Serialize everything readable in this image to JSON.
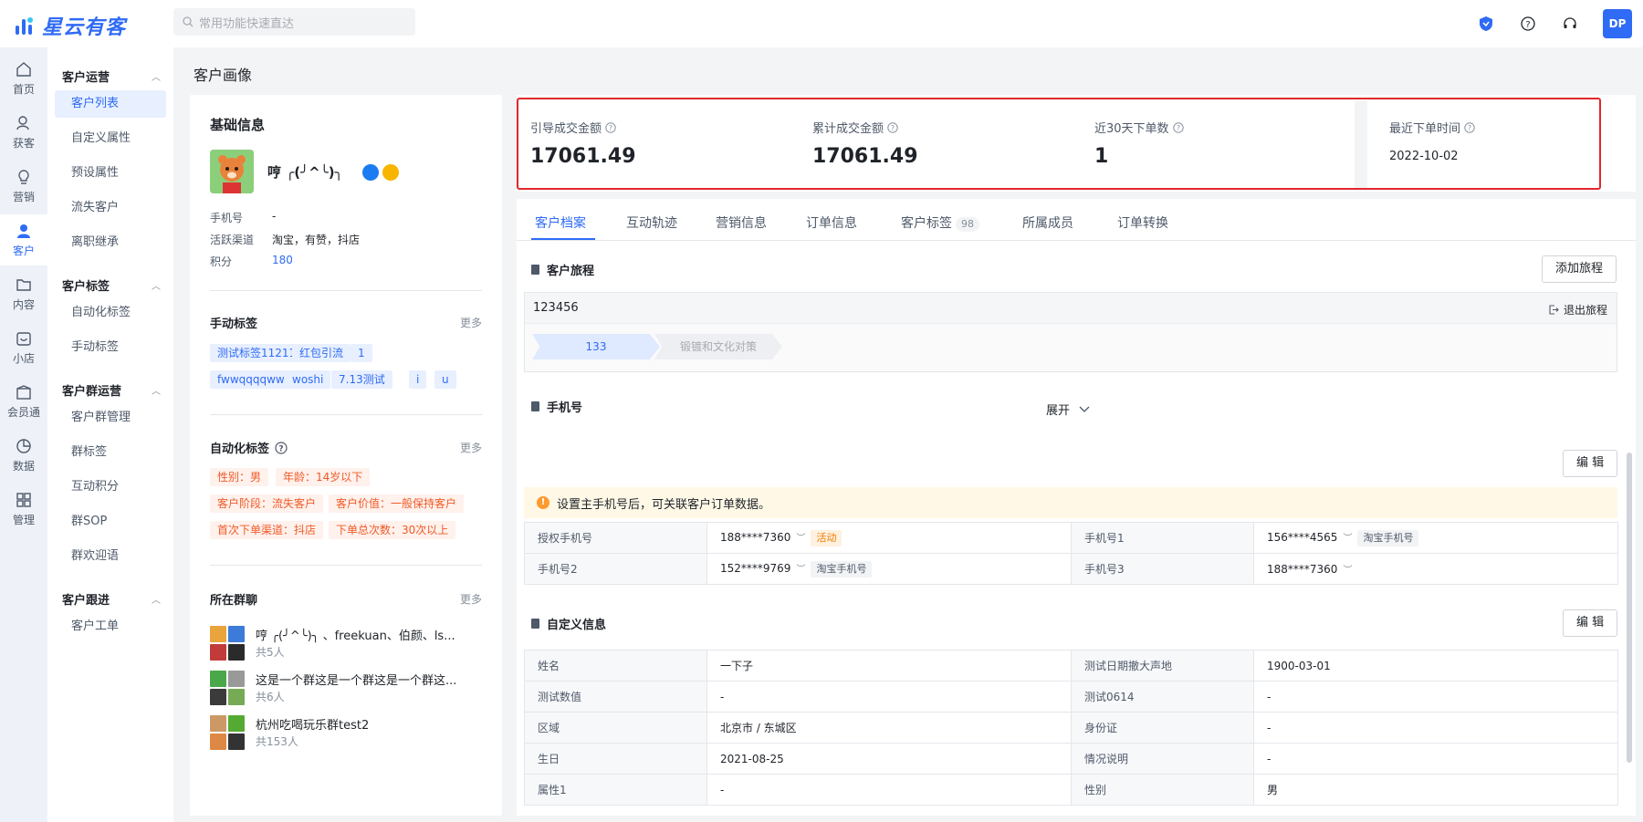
{
  "app": {
    "logo_text": "星云有客",
    "search_placeholder": "常用功能快速直达",
    "user_initials": "DP"
  },
  "rail": [
    {
      "label": "首页",
      "icon": "home-icon"
    },
    {
      "label": "获客",
      "icon": "acquire-icon"
    },
    {
      "label": "营销",
      "icon": "marketing-icon"
    },
    {
      "label": "客户",
      "icon": "customer-icon",
      "active": true
    },
    {
      "label": "内容",
      "icon": "content-icon"
    },
    {
      "label": "小店",
      "icon": "shop-icon"
    },
    {
      "label": "会员通",
      "icon": "member-icon"
    },
    {
      "label": "数据",
      "icon": "data-icon"
    },
    {
      "label": "管理",
      "icon": "manage-icon"
    }
  ],
  "submenu": {
    "groups": [
      {
        "title": "客户运营",
        "items": [
          "客户列表",
          "自定义属性",
          "预设属性",
          "流失客户",
          "离职继承"
        ]
      },
      {
        "title": "客户标签",
        "items": [
          "自动化标签",
          "手动标签"
        ]
      },
      {
        "title": "客户群运营",
        "items": [
          "客户群管理",
          "群标签",
          "互动积分",
          "群SOP",
          "群欢迎语"
        ]
      },
      {
        "title": "客户跟进",
        "items": [
          "客户工单"
        ]
      }
    ]
  },
  "page_title": "客户画像",
  "basic": {
    "title": "基础信息",
    "name": "哼 ╭(╯^╰)╮",
    "phone_label": "手机号",
    "phone_value": "-",
    "channel_label": "活跃渠道",
    "channel_value": "淘宝，有赞，抖店",
    "points_label": "积分",
    "points_value": "180",
    "manual_tags_title": "手动标签",
    "more": "更多",
    "manual_tags": [
      "测试标签11211",
      "红包引流",
      "1",
      "fwwqqqqww",
      "woshi",
      "7.13测试",
      "i",
      "u"
    ],
    "auto_tags_title": "自动化标签",
    "auto_tags": [
      "性别：男",
      "年龄：14岁以下",
      "客户阶段：流失客户",
      "客户价值：一般保持客户",
      "首次下单渠道：抖店",
      "下单总次数：30次以上"
    ],
    "groups_title": "所在群聊",
    "groups": [
      {
        "name": "哼 ╭(╯^╰)╮ 、freekuan、伯颜、ls...",
        "count": "共5人"
      },
      {
        "name": "这是一个群这是一个群这是一个群这...",
        "count": "共6人"
      },
      {
        "name": "杭州吃喝玩乐群test2",
        "count": "共153人"
      }
    ]
  },
  "stats": [
    {
      "label": "引导成交金额",
      "value": "17061.49"
    },
    {
      "label": "累计成交金额",
      "value": "17061.49"
    },
    {
      "label": "近30天下单数",
      "value": "1"
    },
    {
      "label": "最近下单时间",
      "value": "2022-10-02"
    }
  ],
  "tabs": [
    {
      "label": "客户档案",
      "active": true
    },
    {
      "label": "互动轨迹"
    },
    {
      "label": "营销信息"
    },
    {
      "label": "订单信息"
    },
    {
      "label": "客户标签",
      "count": "98"
    },
    {
      "label": "所属成员"
    },
    {
      "label": "订单转换"
    }
  ],
  "journey": {
    "title": "客户旅程",
    "add_button": "添加旅程",
    "name": "123456",
    "exit": "退出旅程",
    "steps": [
      {
        "label": "133",
        "active": true
      },
      {
        "label": "锻镀和文化对策",
        "active": false
      }
    ],
    "expand": "展开"
  },
  "phone_section": {
    "title": "手机号",
    "edit": "编 辑",
    "notice": "设置主手机号后，可关联客户订单数据。",
    "rows": [
      [
        {
          "k": "授权手机号",
          "v": "188****7360",
          "tag": "活动",
          "tag_color": "orange"
        },
        {
          "k": "手机号1",
          "v": "156****4565",
          "tag": "淘宝手机号"
        }
      ],
      [
        {
          "k": "手机号2",
          "v": "152****9769",
          "tag": "淘宝手机号"
        },
        {
          "k": "手机号3",
          "v": "188****7360",
          "tag": ""
        }
      ]
    ]
  },
  "custom_section": {
    "title": "自定义信息",
    "edit": "编 辑",
    "rows": [
      [
        {
          "k": "姓名",
          "v": "一下子"
        },
        {
          "k": "测试日期撤大声地",
          "v": "1900-03-01"
        }
      ],
      [
        {
          "k": "测试数值",
          "v": "-"
        },
        {
          "k": "测试0614",
          "v": "-"
        }
      ],
      [
        {
          "k": "区域",
          "v": "北京市 / 东城区"
        },
        {
          "k": "身份证",
          "v": "-"
        }
      ],
      [
        {
          "k": "生日",
          "v": "2021-08-25"
        },
        {
          "k": "情况说明",
          "v": "-"
        }
      ],
      [
        {
          "k": "属性1",
          "v": "-"
        },
        {
          "k": "性别",
          "v": "男"
        }
      ]
    ]
  },
  "colors": {
    "primary": "#2f6bf5",
    "highlight_border": "#e0282e",
    "tag_orange": "#f05a28"
  }
}
